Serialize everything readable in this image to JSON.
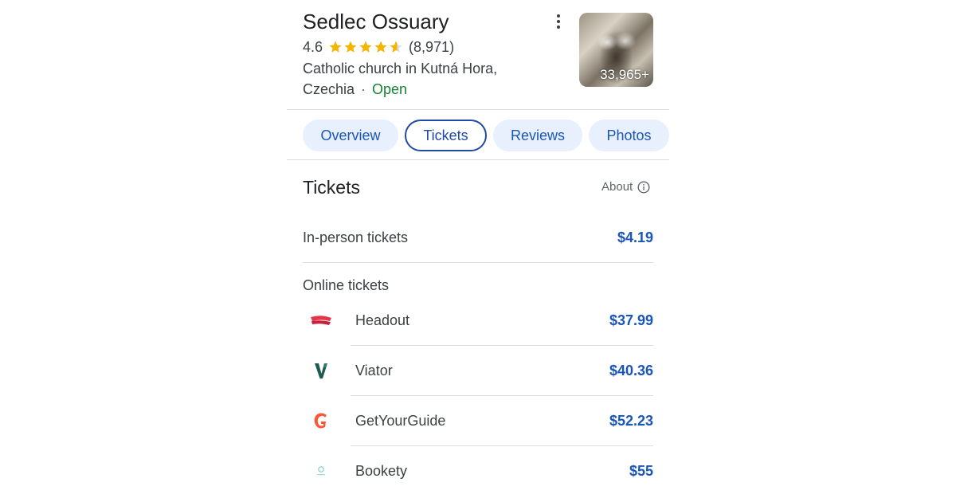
{
  "place": {
    "name": "Sedlec Ossuary",
    "rating": "4.6",
    "review_count": "(8,971)",
    "stars": 4.6,
    "category_line1": "Catholic church in Kutná Hora,",
    "category_line2": "Czechia",
    "status": "Open",
    "photo_count": "33,965+"
  },
  "tabs": [
    {
      "label": "Overview"
    },
    {
      "label": "Tickets",
      "active": true
    },
    {
      "label": "Reviews"
    },
    {
      "label": "Photos"
    }
  ],
  "tickets": {
    "heading": "Tickets",
    "about_label": "About",
    "in_person": {
      "label": "In-person tickets",
      "price": "$4.19"
    },
    "online_heading": "Online tickets",
    "providers": [
      {
        "name": "Headout",
        "price": "$37.99",
        "icon": "headout-logo-icon"
      },
      {
        "name": "Viator",
        "price": "$40.36",
        "icon": "viator-logo-icon"
      },
      {
        "name": "GetYourGuide",
        "price": "$52.23",
        "icon": "getyourguide-logo-icon"
      },
      {
        "name": "Bookety",
        "price": "$55",
        "icon": "bookety-logo-icon"
      }
    ]
  },
  "colors": {
    "accent": "#1a56b8",
    "open": "#188038",
    "star": "#f4b400",
    "tab_bg": "#e8f0fe"
  }
}
